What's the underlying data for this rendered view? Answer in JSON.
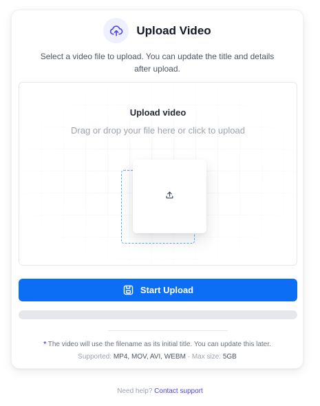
{
  "header": {
    "icon": "cloud-upload-icon",
    "title": "Upload Video"
  },
  "subtitle": "Select a video file to upload. You can update the title and details after upload.",
  "dropzone": {
    "title": "Upload video",
    "hint": "Drag or drop your file here or click to upload",
    "tile_icon": "upload-arrow-icon"
  },
  "start_button": {
    "icon": "save-icon",
    "label": "Start Upload"
  },
  "progress": {
    "value": 0
  },
  "footer_note": {
    "marker": "*",
    "text": "The video will use the filename as its initial title. You can update this later."
  },
  "supported": {
    "label": "Supported:",
    "formats": "MP4, MOV, AVI, WEBM",
    "separator": "·",
    "max_label": "Max size:",
    "max_value": "5GB"
  },
  "help": {
    "prompt": "Need help?",
    "link": "Contact support"
  },
  "colors": {
    "primary": "#0b6ef5",
    "accent": "#4f46e5",
    "dashed": "#60a5fa"
  }
}
